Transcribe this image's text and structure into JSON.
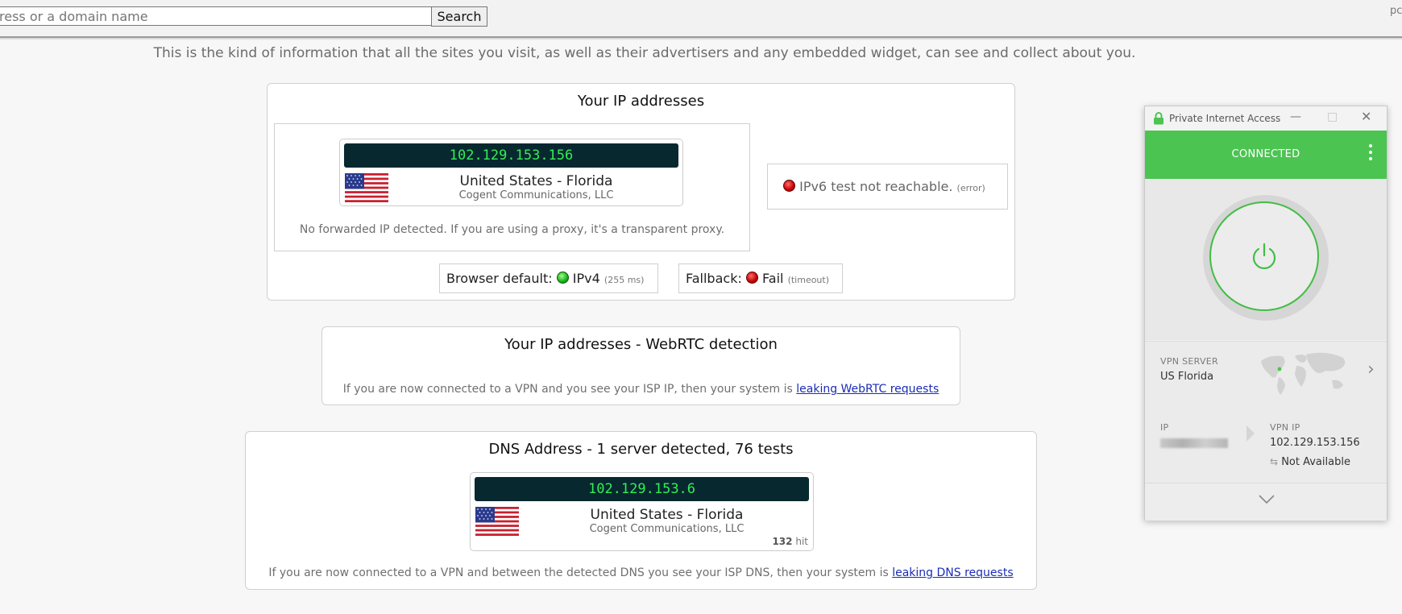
{
  "toolbar": {
    "search_placeholder": "ress or a domain name",
    "search_label": "Search",
    "corner_text": "pc"
  },
  "intro": "This is the kind of information that all the sites you visit, as well as their advertisers and any embedded widget, can see and collect about you.",
  "ip_card": {
    "title": "Your IP addresses",
    "ip": "102.129.153.156",
    "country": "United States - Florida",
    "isp": "Cogent Communications, LLC",
    "forward_note": "No forwarded IP detected. If you are using a proxy, it's a transparent proxy.",
    "ipv6_text": "IPv6 test not reachable.",
    "ipv6_status": "(error)",
    "browser_default_label": "Browser default:",
    "browser_default_value": "IPv4",
    "browser_default_time": "(255 ms)",
    "fallback_label": "Fallback:",
    "fallback_value": "Fail",
    "fallback_status": "(timeout)"
  },
  "webrtc_card": {
    "title": "Your IP addresses - WebRTC detection",
    "note": "If you are now connected to a VPN and you see your ISP IP, then your system is ",
    "link": "leaking WebRTC requests"
  },
  "dns_card": {
    "title": "DNS Address - 1 server detected, 76 tests",
    "ip": "102.129.153.6",
    "country": "United States - Florida",
    "isp": "Cogent Communications, LLC",
    "hits": "132",
    "hits_suffix": "hit",
    "note": "If you are now connected to a VPN and between the detected DNS you see your ISP DNS, then your system is ",
    "link": "leaking DNS requests"
  },
  "pia": {
    "title": "Private Internet Access",
    "status": "CONNECTED",
    "server_label": "VPN SERVER",
    "server_value": "US Florida",
    "ip_label": "IP",
    "vpn_ip_label": "VPN IP",
    "vpn_ip_value": "102.129.153.156",
    "not_available": "Not Available"
  },
  "colors": {
    "pia_green": "#4cc452",
    "ip_bar_bg": "#082830",
    "ip_text": "#33ee55",
    "link": "#1a2db5"
  }
}
